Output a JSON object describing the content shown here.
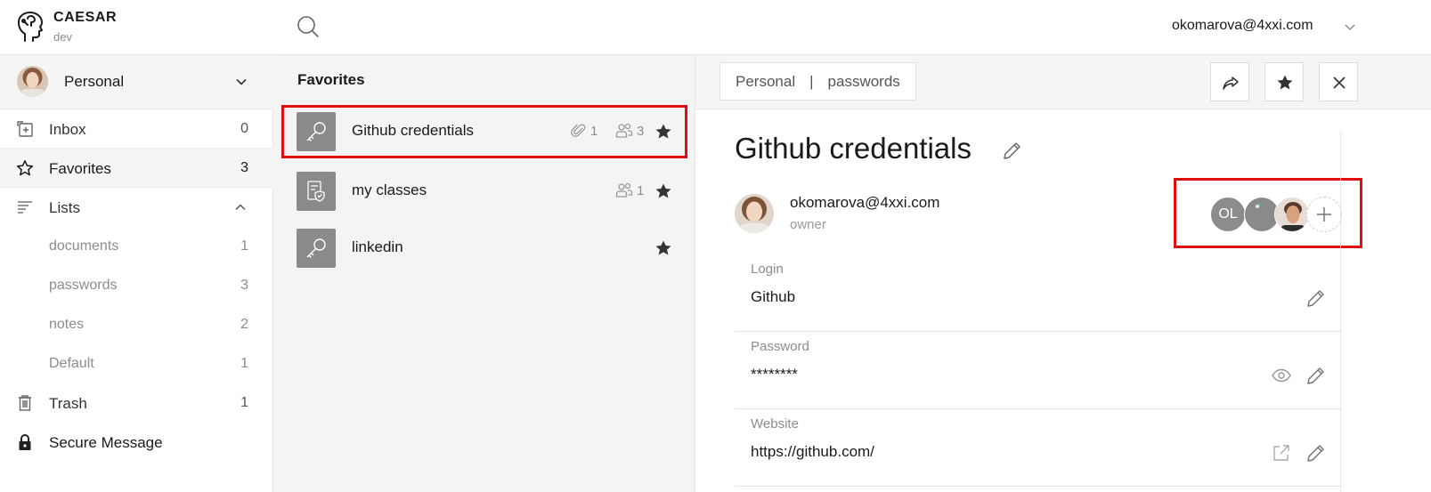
{
  "app": {
    "name": "CAESAR",
    "env": "dev",
    "user_email": "okomarova@4xxi.com",
    "icons": {
      "logo": "head-profile-icon",
      "search": "search-icon",
      "chevron": "chevron-down-icon"
    }
  },
  "sidebar": {
    "team": {
      "name": "Personal",
      "icon": "chevron-down-icon"
    },
    "items": [
      {
        "label": "Inbox",
        "count": "0",
        "icon": "inbox-icon"
      },
      {
        "label": "Favorites",
        "count": "3",
        "icon": "star-outline-icon",
        "active": true
      },
      {
        "label": "Lists",
        "icon": "list-icon",
        "expanded": true
      },
      {
        "label": "documents",
        "count": "1"
      },
      {
        "label": "passwords",
        "count": "3"
      },
      {
        "label": "notes",
        "count": "2"
      },
      {
        "label": "Default",
        "count": "1"
      },
      {
        "label": "Trash",
        "count": "1",
        "icon": "trash-icon"
      },
      {
        "label": "Secure Message",
        "icon": "lock-icon"
      }
    ]
  },
  "list": {
    "title": "Favorites",
    "rows": [
      {
        "label": "Github credentials",
        "icon": "key-icon",
        "attachments": "1",
        "members": "3",
        "favorite": true,
        "selected": true
      },
      {
        "label": "my classes",
        "icon": "note-shield-icon",
        "members": "1",
        "favorite": true
      },
      {
        "label": "linkedin",
        "icon": "key-icon",
        "favorite": true
      }
    ]
  },
  "detail": {
    "breadcrumb": {
      "team": "Personal",
      "separator": "|",
      "list": "passwords"
    },
    "header_buttons": [
      "share-icon",
      "star-icon",
      "close-icon"
    ],
    "title": "Github credentials",
    "owner": {
      "email": "okomarova@4xxi.com",
      "role": "owner"
    },
    "members": [
      {
        "initials": "OL"
      },
      {
        "avatar": "avatar-2"
      },
      {
        "avatar": "avatar-3"
      }
    ],
    "fields": [
      {
        "label": "Login",
        "value": "Github"
      },
      {
        "label": "Password",
        "value": "********"
      },
      {
        "label": "Website",
        "value": "https://github.com/"
      }
    ]
  },
  "colors": {
    "highlight": "#e01010",
    "icon_tile": "#8a8a8a",
    "panel_bg": "#f4f4f4"
  }
}
